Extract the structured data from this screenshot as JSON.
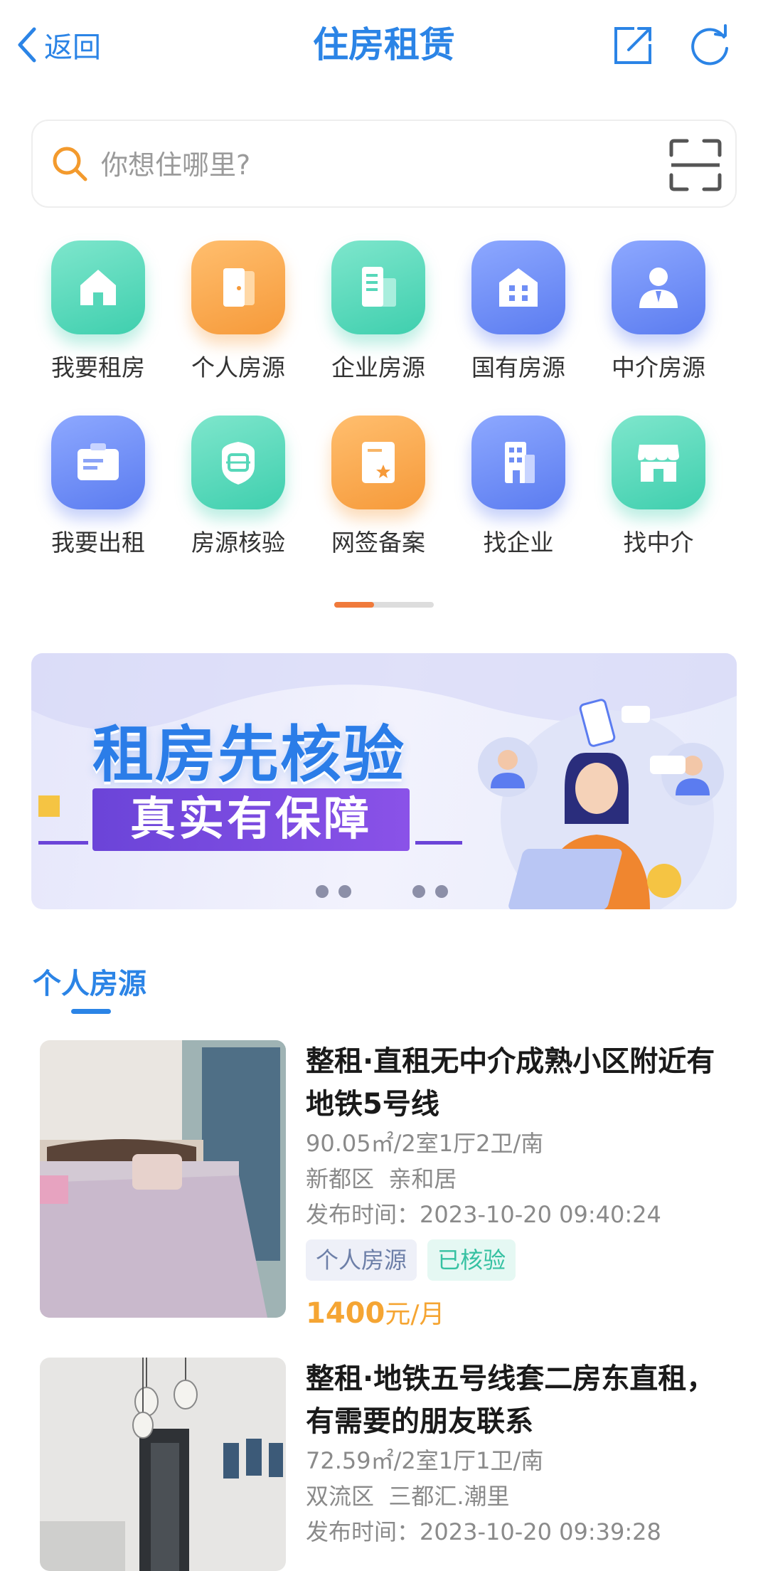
{
  "header": {
    "back_label": "返回",
    "title": "住房租赁"
  },
  "search": {
    "placeholder": "你想住哪里?"
  },
  "grid": [
    {
      "label": "我要租房",
      "icon": "house-icon",
      "color": "teal"
    },
    {
      "label": "个人房源",
      "icon": "door-icon",
      "color": "orange"
    },
    {
      "label": "企业房源",
      "icon": "document-building-icon",
      "color": "teal"
    },
    {
      "label": "国有房源",
      "icon": "building-icon",
      "color": "blue"
    },
    {
      "label": "中介房源",
      "icon": "agent-person-icon",
      "color": "blue"
    },
    {
      "label": "我要出租",
      "icon": "briefcase-icon",
      "color": "blue"
    },
    {
      "label": "房源核验",
      "icon": "face-scan-icon",
      "color": "teal"
    },
    {
      "label": "网签备案",
      "icon": "certificate-icon",
      "color": "orange"
    },
    {
      "label": "找企业",
      "icon": "office-building-icon",
      "color": "blue"
    },
    {
      "label": "找中介",
      "icon": "storefront-icon",
      "color": "teal"
    }
  ],
  "pager": {
    "active": 1,
    "total": 2
  },
  "banner": {
    "line1": "租房先核验",
    "line2": "真实有保障"
  },
  "section": {
    "title": "个人房源"
  },
  "listings": [
    {
      "title": "整租·直租无中介成熟小区附近有地铁5号线",
      "spec": "90.05㎡/2室1厅2卫/南",
      "location": "新都区  亲和居",
      "time": "发布时间：2023-10-20 09:40:24",
      "tags": [
        "个人房源",
        "已核验"
      ],
      "price": "1400",
      "price_unit": "元/月"
    },
    {
      "title": "整租·地铁五号线套二房东直租，有需要的朋友联系",
      "spec": "72.59㎡/2室1厅1卫/南",
      "location": "双流区  三都汇.潮里",
      "time": "发布时间：2023-10-20 09:39:28"
    }
  ],
  "colors": {
    "accent": "#2b84e6",
    "price": "#f5a533",
    "teal": "#3fcfae",
    "orange": "#f69a3a",
    "blue": "#5b7cf0"
  }
}
